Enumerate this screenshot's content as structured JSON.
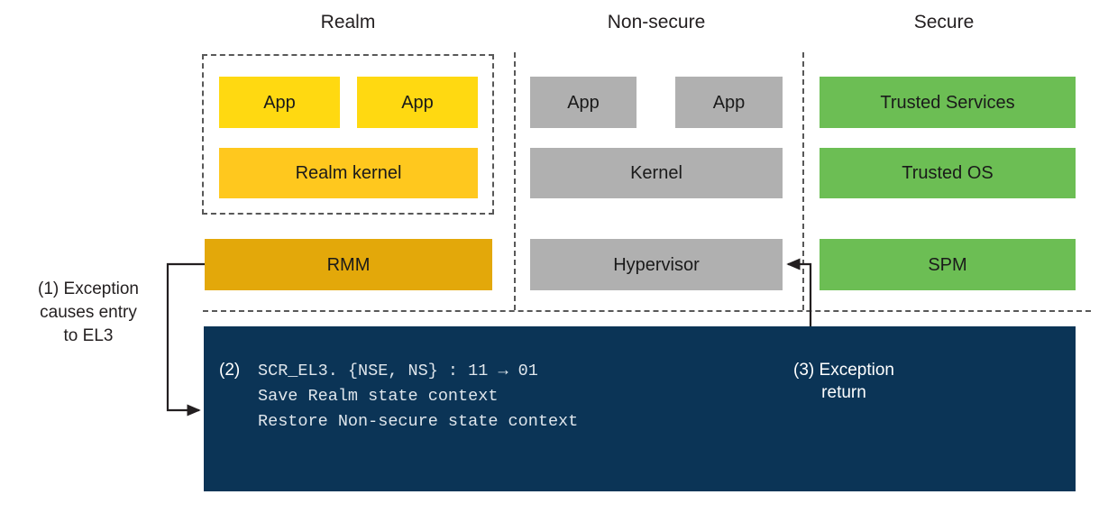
{
  "columns": [
    {
      "id": "realm",
      "title": "Realm"
    },
    {
      "id": "non-secure",
      "title": "Non-secure"
    },
    {
      "id": "secure",
      "title": "Secure"
    }
  ],
  "realm": {
    "apps": [
      {
        "label": "App"
      },
      {
        "label": "App"
      }
    ],
    "kernel": {
      "label": "Realm kernel"
    },
    "monitor": {
      "label": "RMM"
    }
  },
  "non_secure": {
    "apps": [
      {
        "label": "App"
      },
      {
        "label": "App"
      }
    ],
    "kernel": {
      "label": "Kernel"
    },
    "hypervisor": {
      "label": "Hypervisor"
    }
  },
  "secure": {
    "services": {
      "label": "Trusted Services"
    },
    "os": {
      "label": "Trusted OS"
    },
    "spm": {
      "label": "SPM"
    }
  },
  "annotations": {
    "step1": "(1) Exception\ncauses entry\nto EL3",
    "step3": "(3) Exception\nreturn"
  },
  "el3_panel": {
    "step_label": "(2)",
    "code_lines": [
      "SCR_EL3. {NSE, NS} : 11 → 01",
      "Save Realm state context",
      "Restore Non-secure state context"
    ]
  },
  "colors": {
    "app_yellow": "#FFD911",
    "kernel_yellow": "#FFC81E",
    "rmm_amber": "#E3A80A",
    "gray": "#B0B0B0",
    "green": "#6CBE54",
    "el3_navy": "#0B3456",
    "dash_gray": "#585858",
    "arrow_black": "#231F20"
  }
}
